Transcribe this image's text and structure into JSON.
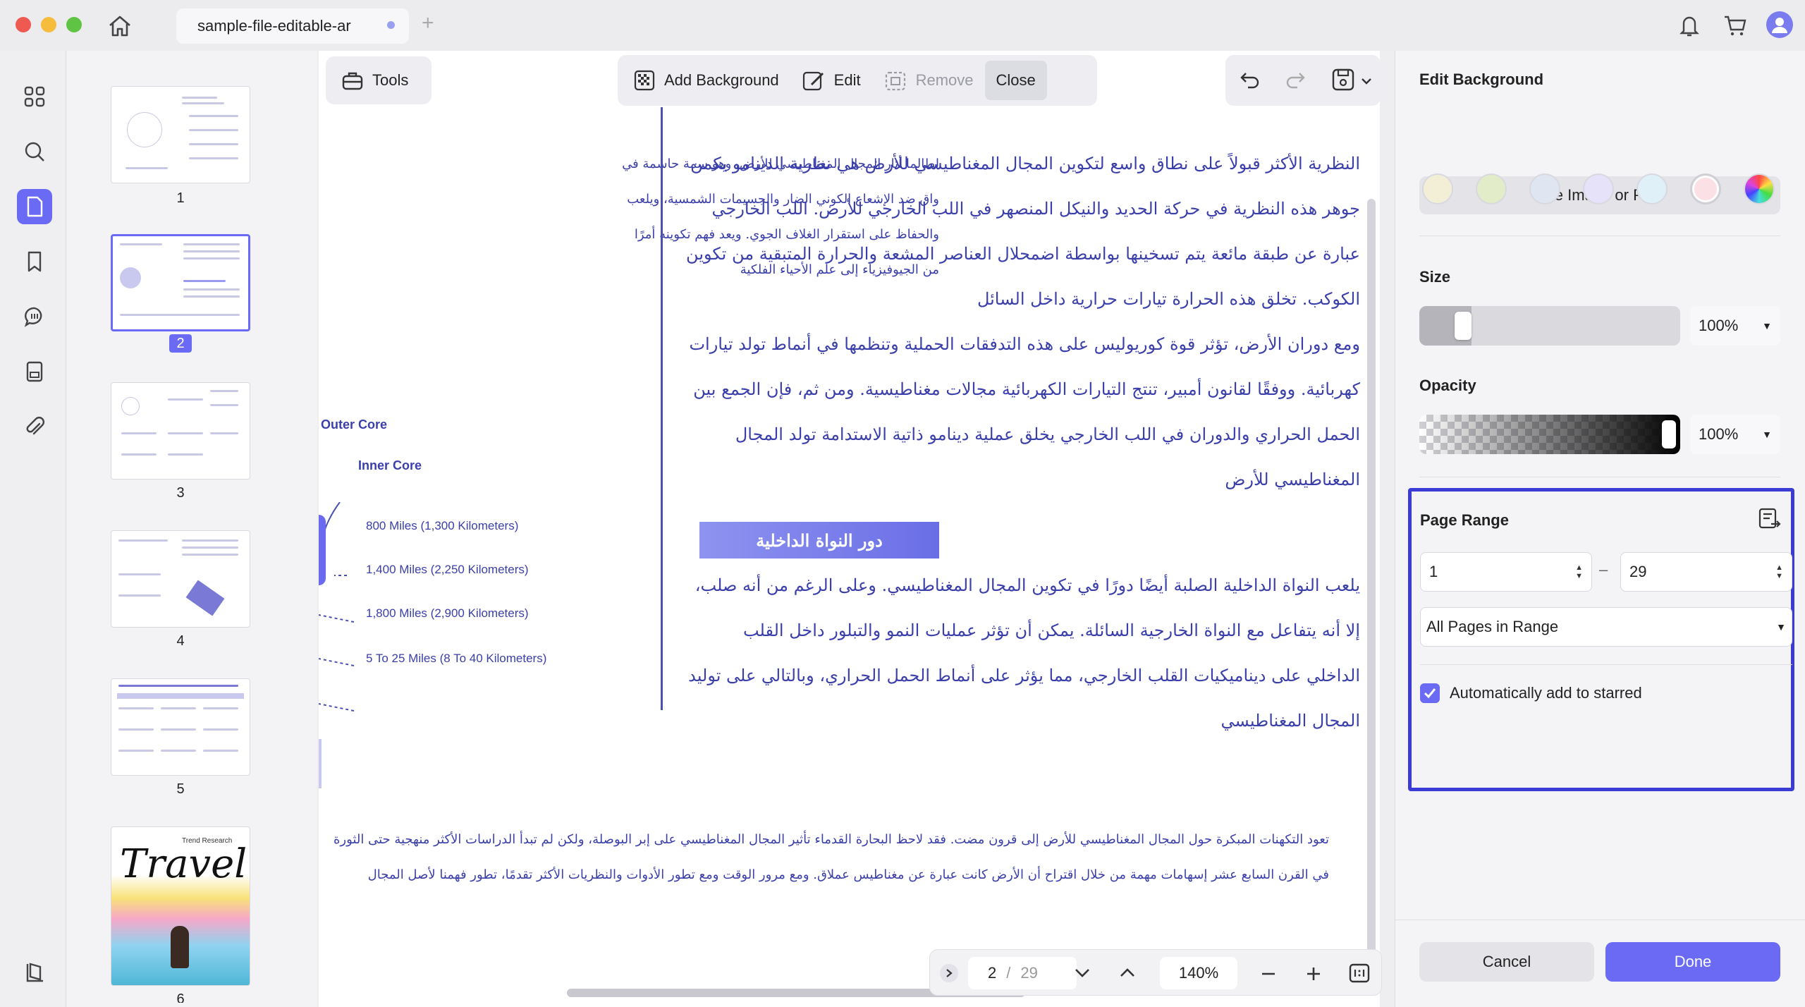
{
  "window": {
    "tab_title": "sample-file-editable-ar",
    "add_tab": "+"
  },
  "colors": {
    "accent": "#6a6af4",
    "page_range_border": "#3b3bd6",
    "text_blue": "#3a3faa"
  },
  "rail": {
    "items": [
      "grid-icon",
      "search-icon",
      "document-icon",
      "bookmark-icon",
      "comment-icon",
      "form-icon",
      "attachment-icon"
    ],
    "bottom": "layers-icon"
  },
  "thumbnails": {
    "pages": [
      "1",
      "2",
      "3",
      "4",
      "5",
      "6"
    ],
    "selected": "2",
    "page6_title": "Travel",
    "page6_subtitle": "Trend Research"
  },
  "toolbar": {
    "tools_label": "Tools",
    "add_background_label": "Add Background",
    "edit_label": "Edit",
    "remove_label": "Remove",
    "close_label": "Close"
  },
  "document": {
    "left_col": [
      "لطالما أثار المجال المغناطيسي للأرض، وهو سمة حاسمة في",
      "واق ضد الإشعاع الكوني الضار والجسيمات الشمسية، ويلعب",
      "والحفاظ على استقرار الغلاف الجوي. ويعد فهم تكوينه أمرًا",
      "من الجيوفيزياء إلى علم الأحياء الفلكية"
    ],
    "diagram": {
      "outer_core": "Outer Core",
      "inner_core": "Inner Core",
      "d1": "800 Miles (1,300 Kilometers)",
      "d2": "1,400 Miles (2,250 Kilometers)",
      "d3": "1,800 Miles (2,900 Kilometers)",
      "d4": "5 To 25 Miles (8 To 40 Kilometers)"
    },
    "right_col_1": [
      "النظرية الأكثر قبولاً على نطاق واسع لتكوين المجال المغناطيسي للأرض هي نظرية الدينامو يكمن",
      "جوهر هذه النظرية في حركة الحديد والنيكل المنصهر في اللب الخارجي للأرض. اللب الخارجي",
      "عبارة عن طبقة مائعة يتم تسخينها بواسطة اضمحلال العناصر المشعة والحرارة المتبقية من تكوين",
      "الكوكب. تخلق هذه الحرارة تيارات حرارية داخل السائل",
      "ومع دوران الأرض، تؤثر قوة كوريوليس على هذه التدفقات الحملية وتنظمها في أنماط تولد تيارات",
      "كهربائية. ووفقًا لقانون أمبير، تنتج التيارات الكهربائية مجالات مغناطيسية. ومن ثم، فإن الجمع بين",
      "الحمل الحراري والدوران في اللب الخارجي يخلق عملية دينامو ذاتية الاستدامة تولد المجال",
      "المغناطيسي للأرض"
    ],
    "section_heading": "دور النواة الداخلية",
    "right_col_2": [
      "يلعب النواة الداخلية الصلبة أيضًا دورًا في تكوين المجال المغناطيسي. وعلى الرغم من أنه صلب،",
      "إلا أنه يتفاعل مع النواة الخارجية السائلة. يمكن أن تؤثر عمليات النمو والتبلور داخل القلب",
      "الداخلي على ديناميكيات القلب الخارجي، مما يؤثر على أنماط الحمل الحراري، وبالتالي على توليد",
      "المجال المغناطيسي"
    ],
    "bottom_lines": [
      "تعود التكهنات المبكرة حول المجال المغناطيسي للأرض إلى قرون مضت. فقد لاحظ البحارة القدماء تأثير المجال المغناطيسي على إبر البوصلة، ولكن لم تبدأ الدراسات الأكثر منهجية حتى الثورة",
      "في القرن السابع عشر إسهامات مهمة من خلال اقتراح أن الأرض كانت عبارة عن مغناطيس عملاق. ومع مرور الوقت ومع تطور الأدوات والنظريات الأكثر تقدمًا، تطور فهمنا لأصل المجال"
    ]
  },
  "panel": {
    "title": "Edit Background",
    "swatches": [
      "#f3efd6",
      "#e2ecc9",
      "#dfe6f2",
      "#e6e2fa",
      "#dff0f8",
      "#fbe0e6"
    ],
    "use_image_label": "Use Image or PDF",
    "size_label": "Size",
    "size_value": "100%",
    "size_level": 0.2,
    "opacity_label": "Opacity",
    "opacity_value": "100%",
    "opacity_level": 1.0,
    "page_range_label": "Page Range",
    "range_from": "1",
    "range_to": "29",
    "range_dash": "–",
    "range_mode": "All Pages in Range",
    "auto_star_label": "Automatically add to starred",
    "auto_star_checked": true,
    "cancel_label": "Cancel",
    "done_label": "Done"
  },
  "navigation": {
    "current_page": "2",
    "separator": "/",
    "total_pages": "29",
    "zoom": "140%"
  }
}
